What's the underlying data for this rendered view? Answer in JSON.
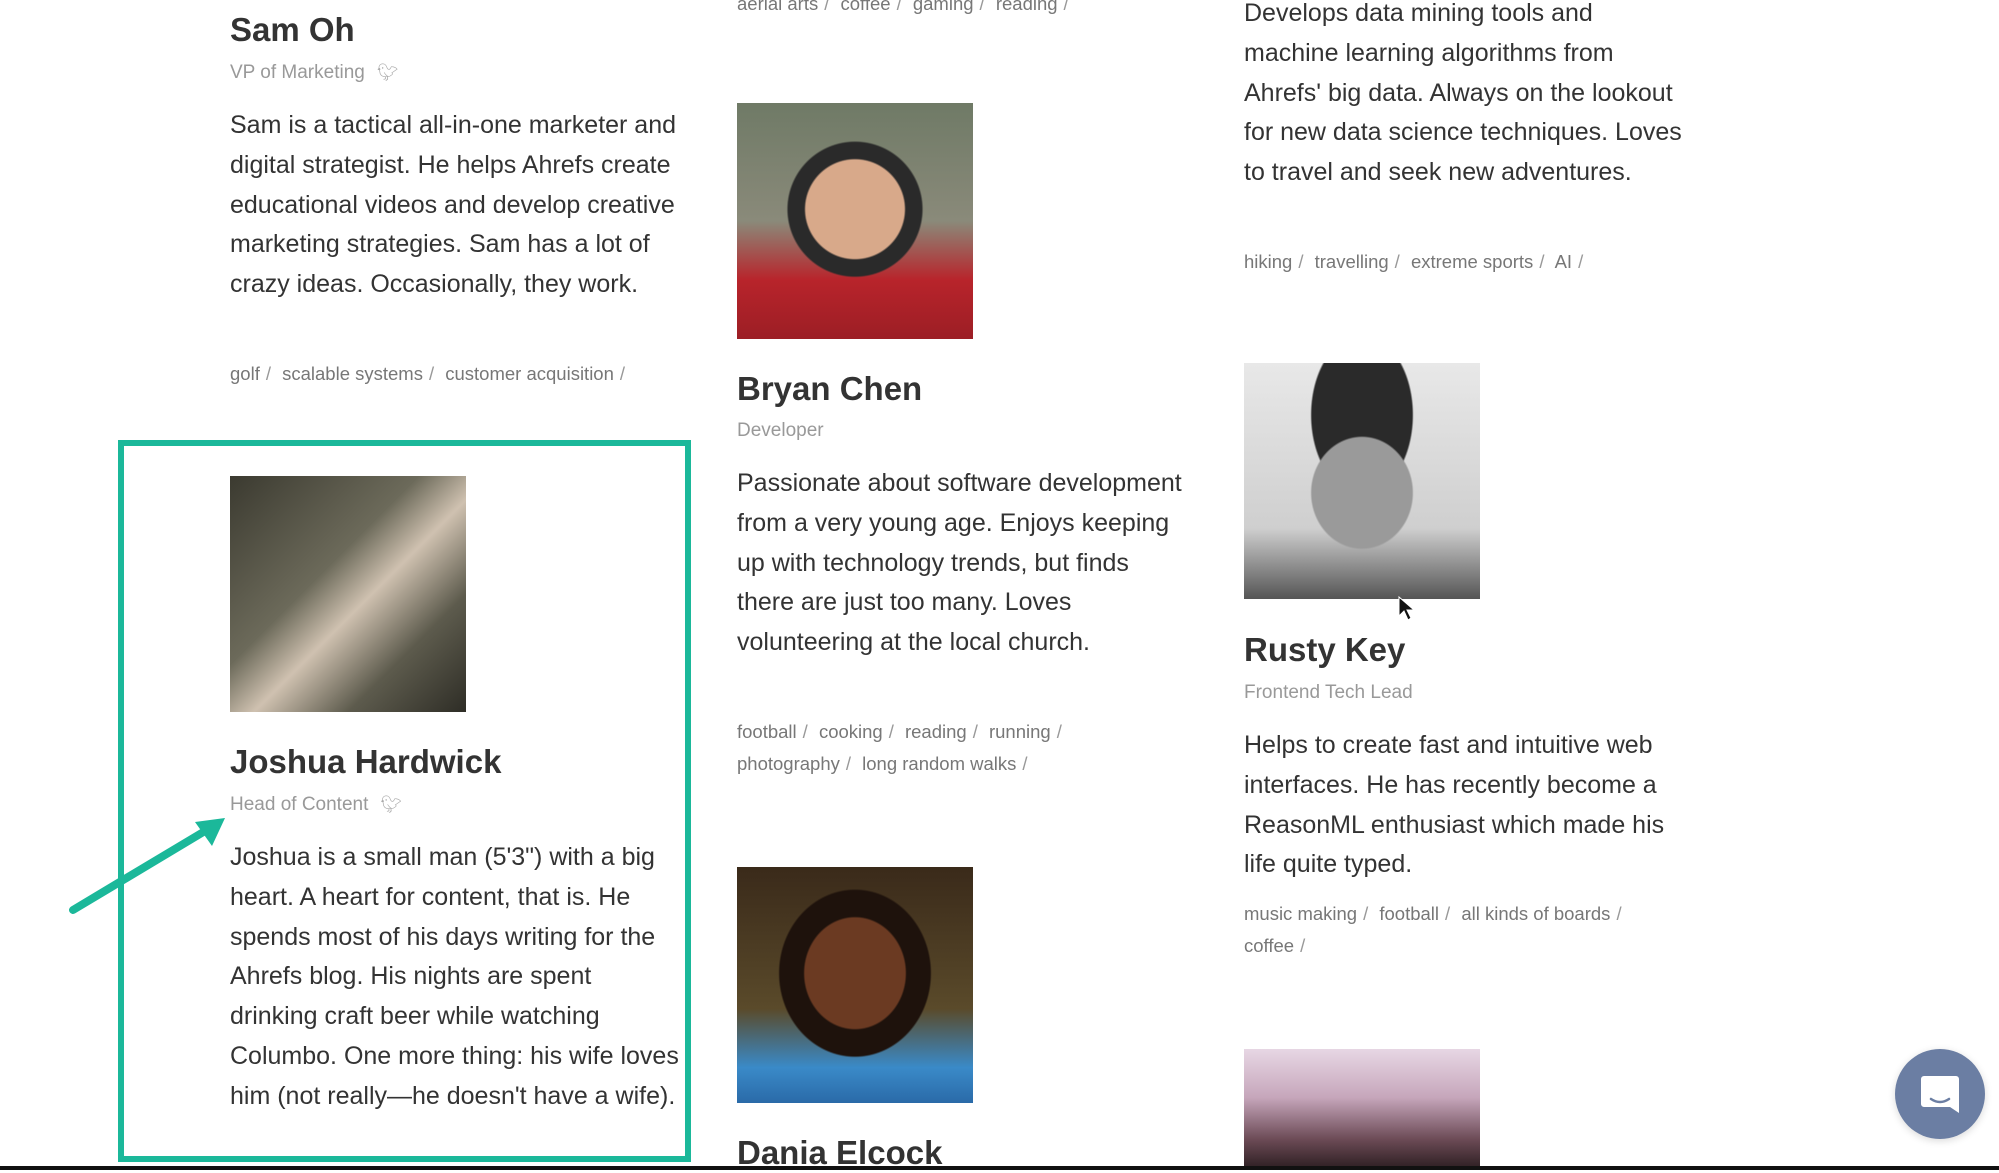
{
  "highlight_color": "#1bb89a",
  "columns": {
    "left": {
      "sam": {
        "name": "Sam Oh",
        "role": "VP of Marketing",
        "bio": "Sam is a tactical all-in-one marketer and digital strategist. He helps Ahrefs create educational videos and develop creative marketing strategies. Sam has a lot of crazy ideas. Occasionally, they work.",
        "tags": [
          "golf",
          "scalable systems",
          "customer acquisition"
        ]
      },
      "joshua": {
        "name": "Joshua Hardwick",
        "role": "Head of Content",
        "bio": "Joshua is a small man (5'3\") with a big heart. A heart for content, that is. He spends most of his days writing for the Ahrefs blog. His nights are spent drinking craft beer while watching Columbo. One more thing: his wife loves him (not really—he doesn't have a wife)."
      }
    },
    "middle": {
      "top_tags": [
        "aerial arts",
        "coffee",
        "gaming",
        "reading"
      ],
      "bryan": {
        "name": "Bryan Chen",
        "role": "Developer",
        "bio": "Passionate about software development from a very young age. Enjoys keeping up with technology trends, but finds there are just too many. Loves volunteering at the local church.",
        "tags": [
          "football",
          "cooking",
          "reading",
          "running",
          "photography",
          "long random walks"
        ]
      },
      "dania": {
        "name": "Dania Elcock"
      }
    },
    "right": {
      "top": {
        "bio": "Develops data mining tools and machine learning algorithms from Ahrefs' big data. Always on the lookout for new data science techniques. Loves to travel and seek new adventures.",
        "tags": [
          "hiking",
          "travelling",
          "extreme sports",
          "AI"
        ]
      },
      "rusty": {
        "name": "Rusty Key",
        "role": "Frontend Tech Lead",
        "bio": "Helps to create fast and intuitive web interfaces. He has recently become a ReasonML enthusiast which made his life quite typed.",
        "tags": [
          "music making",
          "football",
          "all kinds of boards",
          "coffee"
        ]
      }
    }
  },
  "icons": {
    "twitter": "twitter-icon",
    "chat": "chat-icon",
    "arrow": "arrow-annotation",
    "cursor": "mouse-cursor"
  }
}
